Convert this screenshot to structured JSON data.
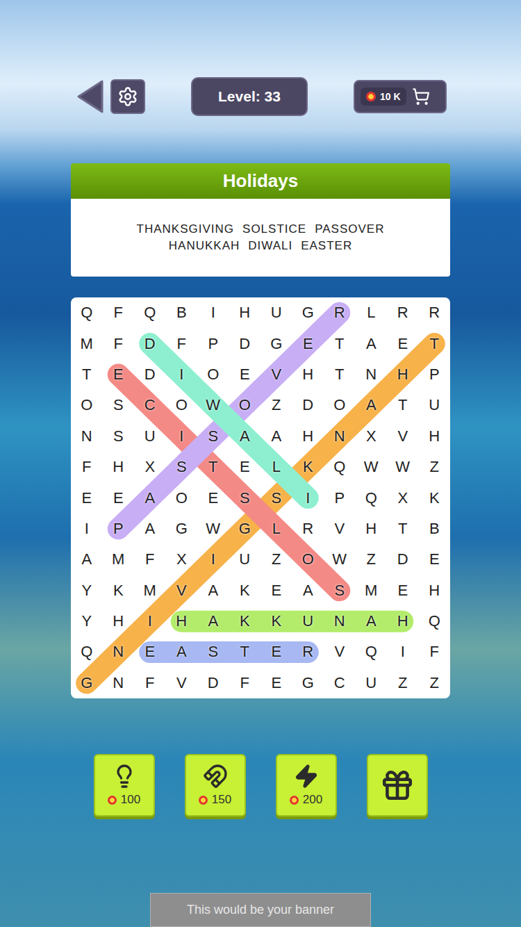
{
  "level": {
    "label": "Level: 33"
  },
  "coins": {
    "amount": "10 K"
  },
  "category": {
    "title": "Holidays"
  },
  "words": [
    {
      "text": "THANKSGIVING",
      "found": true,
      "color": "#f7b24a",
      "from": [
        1,
        11
      ],
      "to": [
        12,
        0
      ]
    },
    {
      "text": "SOLSTICE",
      "found": true,
      "color": "#f48a86",
      "from": [
        2,
        1
      ],
      "to": [
        9,
        8
      ]
    },
    {
      "text": "PASSOVER",
      "found": true,
      "color": "#c8aef5",
      "from": [
        7,
        1
      ],
      "to": [
        0,
        8
      ]
    },
    {
      "text": "HANUKKAH",
      "found": true,
      "color": "#b2ec6a",
      "from": [
        10,
        3
      ],
      "to": [
        10,
        10
      ]
    },
    {
      "text": "DIWALI",
      "found": true,
      "color": "#8eefd0",
      "from": [
        1,
        2
      ],
      "to": [
        6,
        7
      ]
    },
    {
      "text": "EASTER",
      "found": true,
      "color": "#a7b8f2",
      "from": [
        11,
        2
      ],
      "to": [
        11,
        7
      ]
    }
  ],
  "grid": [
    [
      "Q",
      "F",
      "Q",
      "B",
      "I",
      "H",
      "U",
      "G",
      "R",
      "L",
      "R",
      "R"
    ],
    [
      "M",
      "F",
      "D",
      "F",
      "P",
      "D",
      "G",
      "E",
      "T",
      "A",
      "E",
      "T"
    ],
    [
      "T",
      "E",
      "D",
      "I",
      "O",
      "E",
      "V",
      "H",
      "T",
      "N",
      "H",
      "P"
    ],
    [
      "O",
      "S",
      "C",
      "O",
      "W",
      "O",
      "Z",
      "D",
      "O",
      "A",
      "T",
      "U"
    ],
    [
      "N",
      "S",
      "U",
      "I",
      "S",
      "A",
      "A",
      "H",
      "N",
      "X",
      "V",
      "H"
    ],
    [
      "F",
      "H",
      "X",
      "S",
      "T",
      "E",
      "L",
      "K",
      "Q",
      "W",
      "W",
      "Z"
    ],
    [
      "E",
      "E",
      "A",
      "O",
      "E",
      "S",
      "S",
      "I",
      "P",
      "Q",
      "X",
      "K"
    ],
    [
      "I",
      "P",
      "A",
      "G",
      "W",
      "G",
      "L",
      "R",
      "V",
      "H",
      "T",
      "B"
    ],
    [
      "A",
      "M",
      "F",
      "X",
      "I",
      "U",
      "Z",
      "O",
      "W",
      "Z",
      "D",
      "E"
    ],
    [
      "Y",
      "K",
      "M",
      "V",
      "A",
      "K",
      "E",
      "A",
      "S",
      "M",
      "E",
      "H"
    ],
    [
      "Y",
      "H",
      "I",
      "H",
      "A",
      "K",
      "K",
      "U",
      "N",
      "A",
      "H",
      "Q"
    ],
    [
      "Q",
      "N",
      "E",
      "A",
      "S",
      "T",
      "E",
      "R",
      "V",
      "Q",
      "I",
      "F"
    ],
    [
      "G",
      "N",
      "F",
      "V",
      "D",
      "F",
      "E",
      "G",
      "C",
      "U",
      "Z",
      "Z"
    ]
  ],
  "boosters": [
    {
      "kind": "hint",
      "cost": "100"
    },
    {
      "kind": "magnet",
      "cost": "150"
    },
    {
      "kind": "bolt",
      "cost": "200"
    },
    {
      "kind": "gift"
    }
  ],
  "banner": {
    "text": "This would be your banner"
  }
}
